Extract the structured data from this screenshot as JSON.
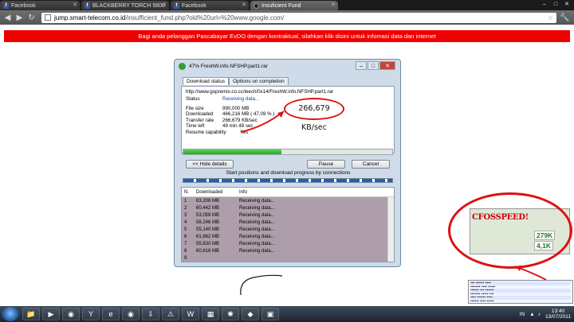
{
  "browser": {
    "tabs": [
      {
        "title": "Facebook",
        "favicon": "facebook-icon",
        "active": false
      },
      {
        "title": "BLACKBERRY TORCH 9800",
        "favicon": "facebook-icon",
        "active": false
      },
      {
        "title": "Facebook",
        "favicon": "facebook-icon",
        "active": false
      },
      {
        "title": "Insuficient Fund",
        "favicon": "globe-icon",
        "active": true
      }
    ],
    "url_host": "jump.smart-telecom.co.id",
    "url_rest": "/insufficient_fund.php?old%20url=%20www.google.com/"
  },
  "banner": {
    "text": "Bagi anda pelanggan Pascabayar EvDO dengan kontraktual, silahkan klik disini untuk infomasi data dan internet",
    "color": "#ee0000"
  },
  "download": {
    "window_title": "47% FreshW.info.NFSHP.part1.rar",
    "tabs": [
      "Download status",
      "Options on completion"
    ],
    "url": "http://www.gopremix.co.cc/leech/0x14/FreshW.info.NFSHP.part1.rar",
    "status_label": "Status",
    "status_value": "Receiving data...",
    "file_size_label": "File size",
    "file_size_value": "990,000  MB",
    "downloaded_label": "Downloaded",
    "downloaded_value": "466,216  MB  ( 47,09 % )",
    "transfer_label": "Transfer rate",
    "transfer_value": "266,679  KB/sec",
    "time_left_label": "Time left",
    "time_left_value": "49 min 48 sec",
    "resume_label": "Resume capability",
    "resume_value": "Yes",
    "progress_fraction": 0.47,
    "hide_details": "<< Hide details",
    "pause": "Pause",
    "cancel": "Cancel",
    "connections_label": "Start positions and download progress by connections",
    "list_headers": [
      "N.",
      "Downloaded",
      "Info"
    ],
    "connections": [
      {
        "n": "1",
        "downloaded": "63,208  MB",
        "info": "Receiving data..."
      },
      {
        "n": "2",
        "downloaded": "60,442  MB",
        "info": "Receiving data..."
      },
      {
        "n": "3",
        "downloaded": "53,059  MB",
        "info": "Receiving data..."
      },
      {
        "n": "4",
        "downloaded": "56,246  MB",
        "info": "Receiving data..."
      },
      {
        "n": "5",
        "downloaded": "55,140  MB",
        "info": "Receiving data..."
      },
      {
        "n": "6",
        "downloaded": "61,862  MB",
        "info": "Receiving data..."
      },
      {
        "n": "7",
        "downloaded": "55,630  MB",
        "info": "Receiving data..."
      },
      {
        "n": "8",
        "downloaded": "60,616  MB",
        "info": "Receiving data..."
      },
      {
        "n": "9",
        "downloaded": "",
        "info": ""
      }
    ]
  },
  "annotations": {
    "speed_callout": "266,679  KB/sec",
    "cfosspeed_label": "CFOSSPEED!",
    "rate_up": "279K",
    "rate_down": "4,1K"
  },
  "taskbar": {
    "language": "IN",
    "time": "13:40",
    "date": "13/07/2011"
  }
}
